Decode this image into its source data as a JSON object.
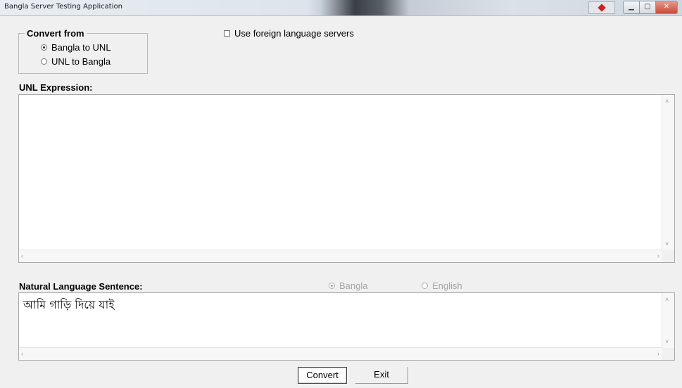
{
  "window": {
    "title": "Bangla Server Testing Application",
    "minimize_glyph": "▁",
    "maximize_glyph": "▢",
    "close_glyph": "✕"
  },
  "convert_from": {
    "legend": "Convert from",
    "options": [
      {
        "label": "Bangla to UNL",
        "checked": true
      },
      {
        "label": "UNL  to Bangla",
        "checked": false
      }
    ]
  },
  "foreign_servers": {
    "label": "Use foreign language servers",
    "checked": false
  },
  "unl": {
    "label": "UNL Expression:",
    "value": ""
  },
  "natural": {
    "label": "Natural Language Sentence:",
    "language_options": [
      {
        "label": "Bangla",
        "checked": true,
        "enabled": false
      },
      {
        "label": "English",
        "checked": false,
        "enabled": false
      }
    ],
    "value": "আমি গাড়ি দিয়ে যাই"
  },
  "buttons": {
    "convert": "Convert",
    "exit": "Exit"
  },
  "scroll_glyphs": {
    "up": "˄",
    "down": "˅",
    "left": "‹",
    "right": "›"
  }
}
